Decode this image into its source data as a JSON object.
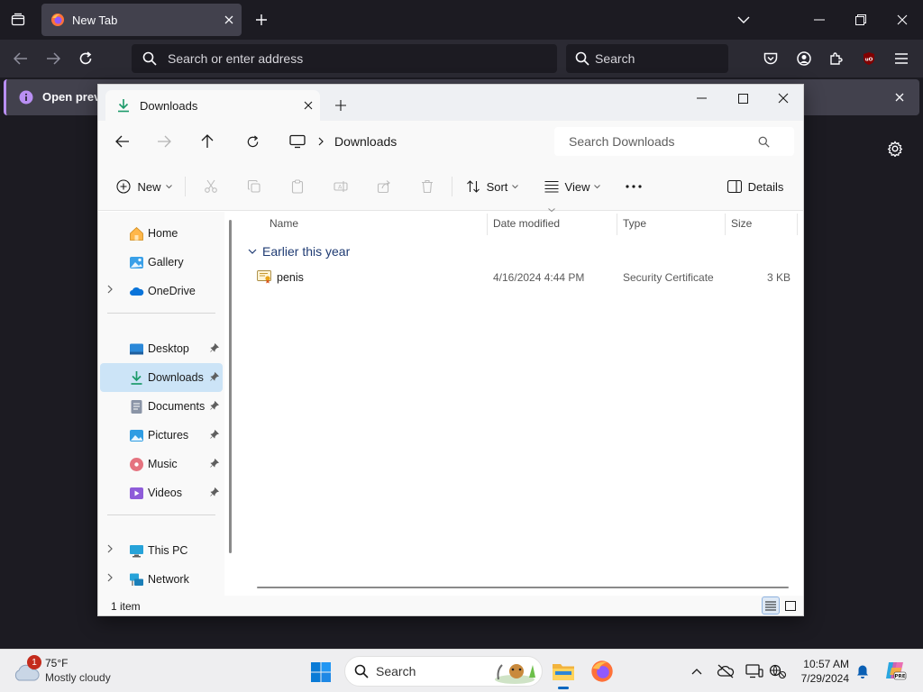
{
  "firefox": {
    "tab_title": "New Tab",
    "url_placeholder": "Search or enter address",
    "search_placeholder": "Search",
    "infobar_text": "Open previo",
    "colors": {
      "accent": "#b98ff3",
      "chrome_bg": "#1c1b22",
      "toolbar_bg": "#2b2a33"
    }
  },
  "explorer": {
    "tab_title": "Downloads",
    "breadcrumb": {
      "location": "Downloads"
    },
    "search_placeholder": "Search Downloads",
    "toolbar": {
      "new_label": "New",
      "sort_label": "Sort",
      "view_label": "View",
      "details_label": "Details"
    },
    "sidebar": {
      "items": [
        {
          "label": "Home",
          "icon": "home-icon"
        },
        {
          "label": "Gallery",
          "icon": "gallery-icon"
        },
        {
          "label": "OneDrive",
          "icon": "onedrive-icon"
        },
        {
          "label": "Desktop",
          "icon": "desktop-icon"
        },
        {
          "label": "Downloads",
          "icon": "downloads-icon"
        },
        {
          "label": "Documents",
          "icon": "documents-icon"
        },
        {
          "label": "Pictures",
          "icon": "pictures-icon"
        },
        {
          "label": "Music",
          "icon": "music-icon"
        },
        {
          "label": "Videos",
          "icon": "videos-icon"
        },
        {
          "label": "This PC",
          "icon": "this-pc-icon"
        },
        {
          "label": "Network",
          "icon": "network-icon"
        }
      ]
    },
    "columns": [
      "Name",
      "Date modified",
      "Type",
      "Size"
    ],
    "group_label": "Earlier this year",
    "files": [
      {
        "name": "penis",
        "date": "4/16/2024 4:44 PM",
        "type": "Security Certificate",
        "size": "3 KB"
      }
    ],
    "status": "1 item",
    "colors": {
      "selected": "#cce4f7",
      "group_heading": "#1f3b73"
    }
  },
  "taskbar": {
    "weather": {
      "temp": "75°F",
      "condition": "Mostly cloudy",
      "badge": "1"
    },
    "search_placeholder": "Search",
    "time": "10:57 AM",
    "date": "7/29/2024"
  }
}
